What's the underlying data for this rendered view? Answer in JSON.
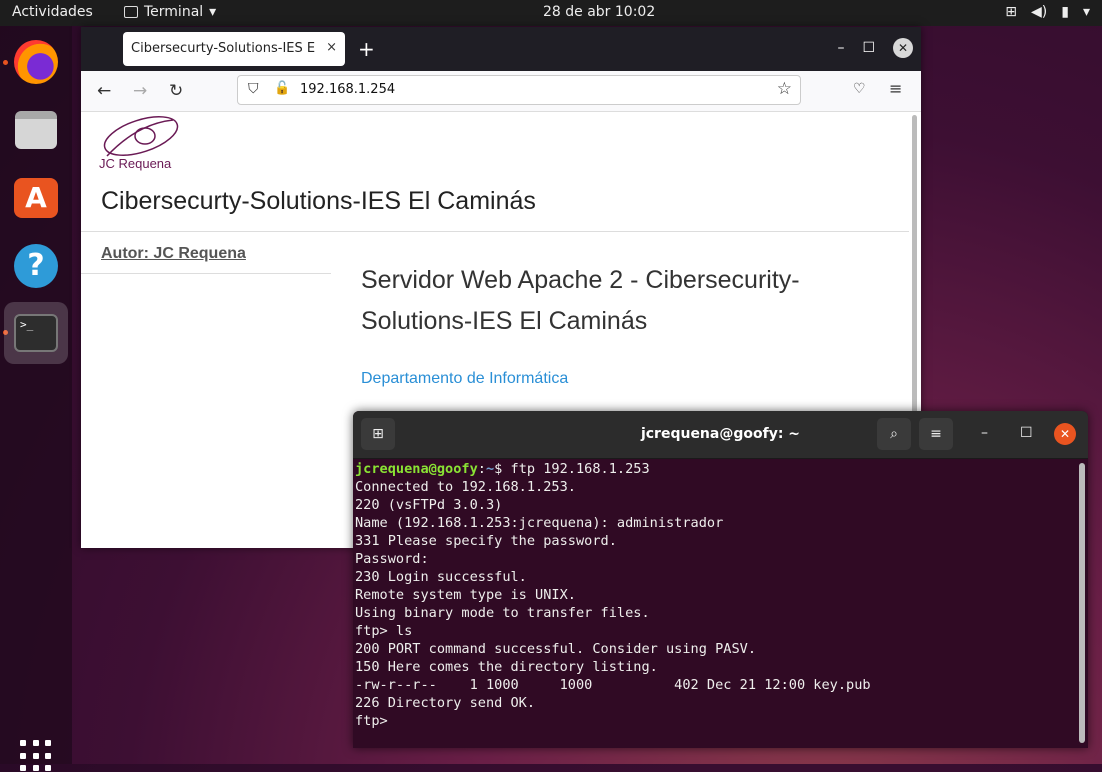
{
  "topbar": {
    "activities": "Actividades",
    "app_name": "Terminal",
    "app_arrow": "▾",
    "clock": "28 de abr  10:02",
    "tray": [
      "network-icon",
      "volume-icon",
      "battery-icon",
      "menu-arrow-icon"
    ]
  },
  "dock": {
    "items": [
      "firefox-icon",
      "files-icon",
      "software-icon",
      "help-icon",
      "terminal-icon"
    ],
    "apps_grid": "show-applications-icon",
    "terminal_glyph": ">_"
  },
  "browser": {
    "tab_title": "Cibersecurty-Solutions-IES E",
    "tab_close": "×",
    "new_tab": "+",
    "url": "192.168.1.254",
    "page": {
      "logo_text": "JC Requena",
      "site_title": "Cibersecurty-Solutions-IES El Caminás",
      "author": "Autor: JC Requena",
      "heading": "Servidor Web Apache 2 - Cibersecurity-Solutions-IES El Caminás",
      "link": "Departamento de Informática"
    },
    "colors": {
      "tabbar": "#1f1e25",
      "link": "#2a8fd6"
    }
  },
  "terminal": {
    "title": "jcrequena@goofy: ~",
    "prompt_user": "jcrequena@goofy",
    "prompt_sep": ":",
    "prompt_path": "~",
    "prompt_cmd": "$ ftp 192.168.1.253",
    "lines": [
      "Connected to 192.168.1.253.",
      "220 (vsFTPd 3.0.3)",
      "Name (192.168.1.253:jcrequena): administrador",
      "331 Please specify the password.",
      "Password:",
      "230 Login successful.",
      "Remote system type is UNIX.",
      "Using binary mode to transfer files.",
      "ftp> ls",
      "200 PORT command successful. Consider using PASV.",
      "150 Here comes the directory listing.",
      "-rw-r--r--    1 1000     1000          402 Dec 21 12:00 key.pub",
      "226 Directory send OK.",
      "ftp> "
    ],
    "colors": {
      "background": "#300a24",
      "user": "#8ae234",
      "path": "#729fcf"
    }
  }
}
